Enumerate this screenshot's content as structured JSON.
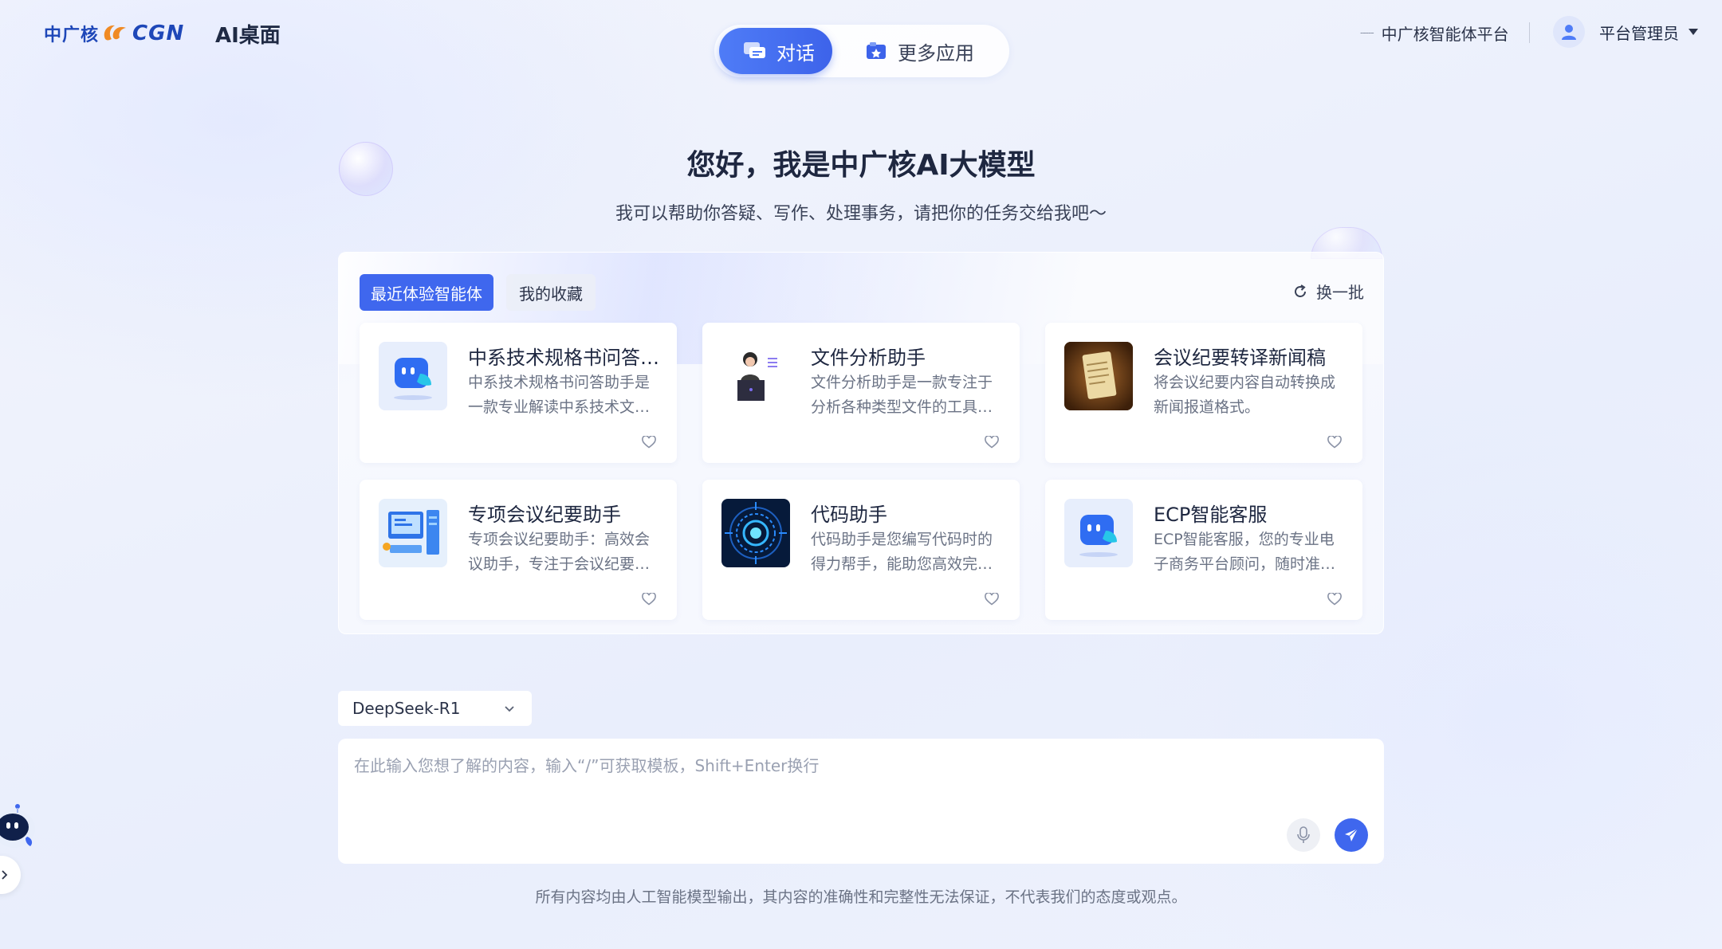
{
  "header": {
    "logo_cn": "中广核",
    "logo_en": "CGN",
    "app_title": "AI桌面",
    "mode_tabs": [
      {
        "label": "对话",
        "icon": "chat-icon",
        "active": true
      },
      {
        "label": "更多应用",
        "icon": "apps-icon",
        "active": false
      }
    ],
    "platform_link": "中广核智能体平台",
    "user_name": "平台管理员"
  },
  "hero": {
    "greeting": "您好，我是中广核AI大模型",
    "subtitle": "我可以帮助你答疑、写作、处理事务，请把你的任务交给我吧～"
  },
  "agents": {
    "tabs": [
      {
        "label": "最近体验智能体",
        "active": true
      },
      {
        "label": "我的收藏",
        "active": false
      }
    ],
    "refresh_label": "换一批",
    "cards": [
      {
        "title": "中系技术规格书问答助手",
        "desc": "中系技术规格书问答助手是一款专业解读中系技术文档的智能助手",
        "icon": "robot-chat-icon"
      },
      {
        "title": "文件分析助手",
        "desc": "文件分析助手是一款专注于分析各种类型文件的工具，帮助用户快速理解",
        "icon": "person-laptop-icon"
      },
      {
        "title": "会议纪要转译新闻稿",
        "desc": "将会议纪要内容自动转换成新闻报道格式。",
        "icon": "document-scroll-icon"
      },
      {
        "title": "专项会议纪要助手",
        "desc": "专项会议纪要助手：高效会议助手，专注于会议纪要整理",
        "icon": "computer-workstation-icon"
      },
      {
        "title": "代码助手",
        "desc": "代码助手是您编写代码时的得力帮手，能助您高效完成开发",
        "icon": "tech-circle-icon"
      },
      {
        "title": "ECP智能客服",
        "desc": "ECP智能客服，您的专业电子商务平台顾问，随时准备为您服务",
        "icon": "robot-chat-icon"
      }
    ]
  },
  "composer": {
    "model": "DeepSeek-R1",
    "placeholder": "在此输入您想了解的内容，输入“/”可获取模板，Shift+Enter换行"
  },
  "disclaimer": "所有内容均由人工智能模型输出，其内容的准确性和完整性无法保证，不代表我们的态度或观点。",
  "colors": {
    "primary": "#3f67ee",
    "brand": "#1e47b8",
    "logo_orange": "#f08a24"
  }
}
